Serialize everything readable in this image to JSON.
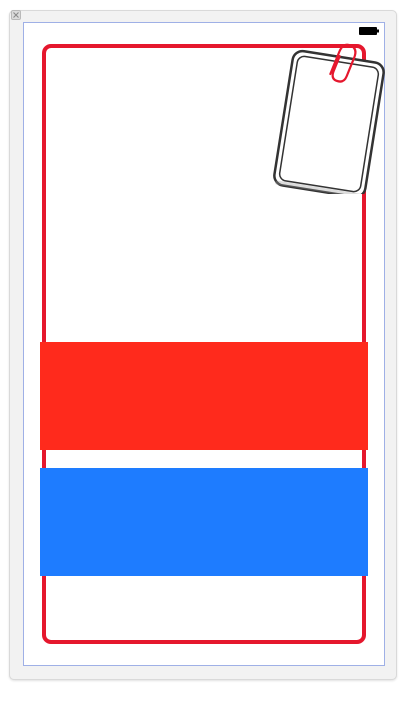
{
  "canvas": {
    "window_icon": "close-box-icon",
    "status_icon": "battery-icon",
    "note_icon": "paperclip-note-icon"
  },
  "colors": {
    "card_outline": "#e5172d",
    "band_red": "#ff2a1c",
    "band_blue": "#1e7cff",
    "view_bounds": "#9fb0e6",
    "paperclip": "#e5172d"
  }
}
